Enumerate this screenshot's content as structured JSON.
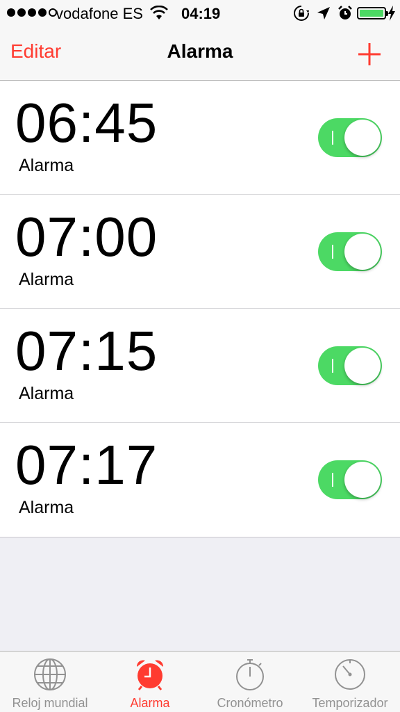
{
  "status_bar": {
    "carrier": "vodafone ES",
    "time": "04:19",
    "signal_bars_filled": 4,
    "signal_bars_total": 5,
    "battery_level": 1.0,
    "icons": [
      "wifi-icon",
      "rotation-lock-icon",
      "location-arrow-icon",
      "alarm-clock-icon",
      "battery-icon",
      "charging-bolt-icon"
    ]
  },
  "nav": {
    "edit_label": "Editar",
    "title": "Alarma",
    "add_icon": "plus-icon"
  },
  "alarms": [
    {
      "time": "06:45",
      "label": "Alarma",
      "enabled": true
    },
    {
      "time": "07:00",
      "label": "Alarma",
      "enabled": true
    },
    {
      "time": "07:15",
      "label": "Alarma",
      "enabled": true
    },
    {
      "time": "07:17",
      "label": "Alarma",
      "enabled": true
    }
  ],
  "tabs": [
    {
      "label": "Reloj mundial",
      "icon": "globe-icon",
      "active": false
    },
    {
      "label": "Alarma",
      "icon": "alarm-clock-icon",
      "active": true
    },
    {
      "label": "Cronómetro",
      "icon": "stopwatch-icon",
      "active": false
    },
    {
      "label": "Temporizador",
      "icon": "timer-icon",
      "active": false
    }
  ],
  "colors": {
    "accent": "#ff3b30",
    "toggle_on": "#4cd964",
    "tab_inactive": "#929292"
  }
}
